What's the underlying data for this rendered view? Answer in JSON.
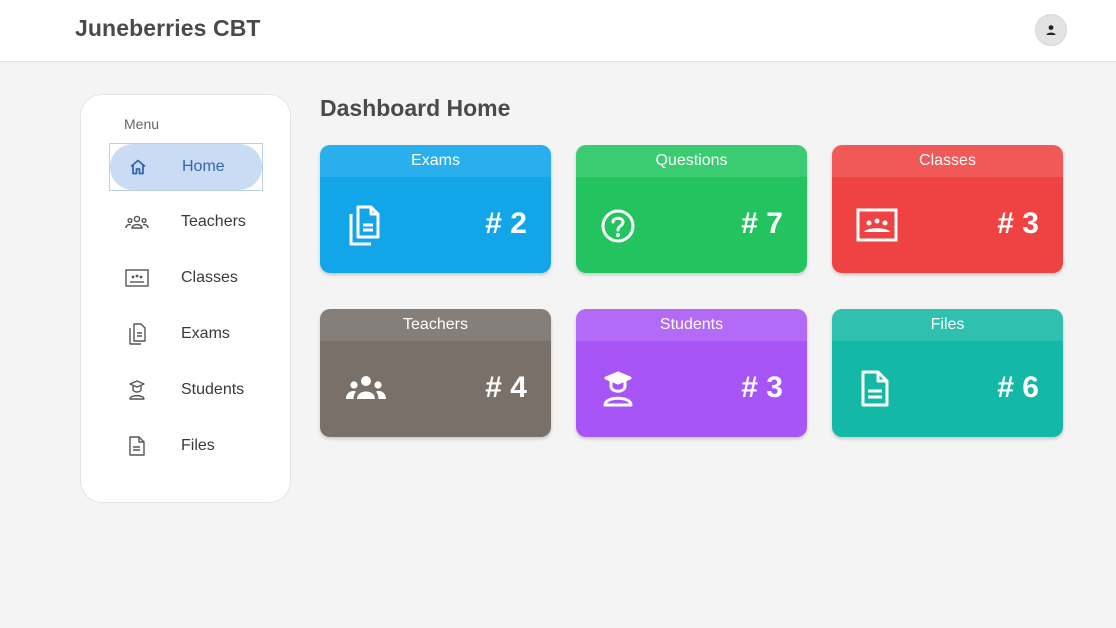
{
  "app": {
    "title": "Juneberries CBT"
  },
  "header": {
    "avatar_icon": "person-icon"
  },
  "sidebar": {
    "menu_label": "Menu",
    "items": [
      {
        "label": "Home",
        "icon": "home-icon",
        "active": true
      },
      {
        "label": "Teachers",
        "icon": "group-icon"
      },
      {
        "label": "Classes",
        "icon": "classroom-icon"
      },
      {
        "label": "Exams",
        "icon": "documents-icon"
      },
      {
        "label": "Students",
        "icon": "student-icon"
      },
      {
        "label": "Files",
        "icon": "file-icon"
      }
    ]
  },
  "main": {
    "title": "Dashboard Home",
    "cards": [
      {
        "title": "Exams",
        "value": "# 2",
        "icon": "documents-icon",
        "color": "#12a6e8",
        "head_color": "#29b0ec"
      },
      {
        "title": "Questions",
        "value": "# 7",
        "icon": "question-circle-icon",
        "color": "#23c45f",
        "head_color": "#3bcb70"
      },
      {
        "title": "Classes",
        "value": "# 3",
        "icon": "classroom-icon",
        "color": "#ef4343",
        "head_color": "#f15858"
      },
      {
        "title": "Teachers",
        "value": "# 4",
        "icon": "group-icon",
        "color": "#797069",
        "head_color": "#867e78"
      },
      {
        "title": "Students",
        "value": "# 3",
        "icon": "student-icon",
        "color": "#a855f7",
        "head_color": "#b26af7"
      },
      {
        "title": "Files",
        "value": "# 6",
        "icon": "file-icon",
        "color": "#14b8a6",
        "head_color": "#2fc0b0"
      }
    ]
  }
}
